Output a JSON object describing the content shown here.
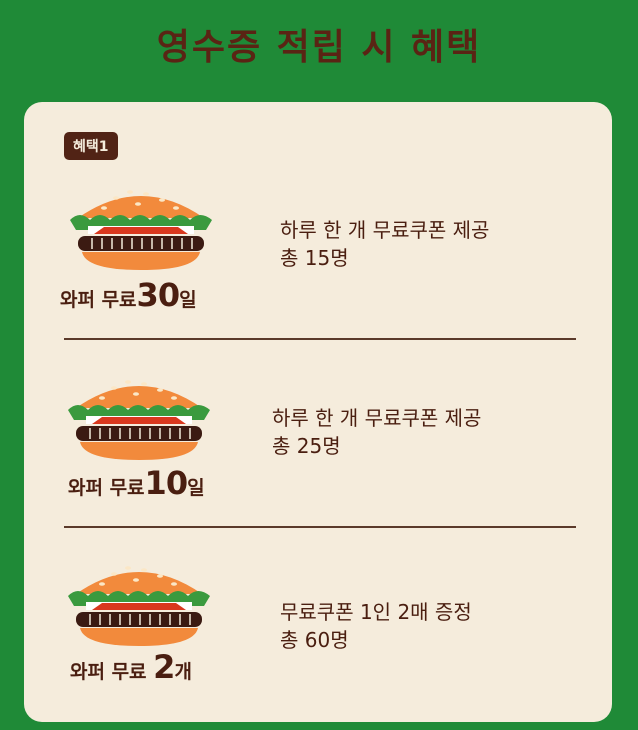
{
  "page": {
    "title": "영수증 적립 시 혜택"
  },
  "badge": "혜택1",
  "benefits": [
    {
      "caption_prefix": "와퍼 무료",
      "caption_number": "30",
      "caption_unit": "일",
      "desc_line1": "하루 한 개 무료쿠폰 제공",
      "desc_line2": "총 15명"
    },
    {
      "caption_prefix": "와퍼 무료",
      "caption_number": "10",
      "caption_unit": "일",
      "desc_line1": "하루 한 개 무료쿠폰 제공",
      "desc_line2": "총 25명"
    },
    {
      "caption_prefix": "와퍼 무료",
      "caption_number": "2",
      "caption_unit": "개",
      "desc_line1": "무료쿠폰 1인 2매 증정",
      "desc_line2": "총 60명"
    }
  ],
  "colors": {
    "background": "#1f8a37",
    "card": "#f5ecdc",
    "text": "#4a1e10",
    "bun": "#f28a3c",
    "lettuce": "#3a9a3e",
    "tomato": "#d9381e",
    "patty": "#3b1a12"
  },
  "icons": [
    "burger-icon",
    "burger-icon",
    "burger-icon"
  ]
}
